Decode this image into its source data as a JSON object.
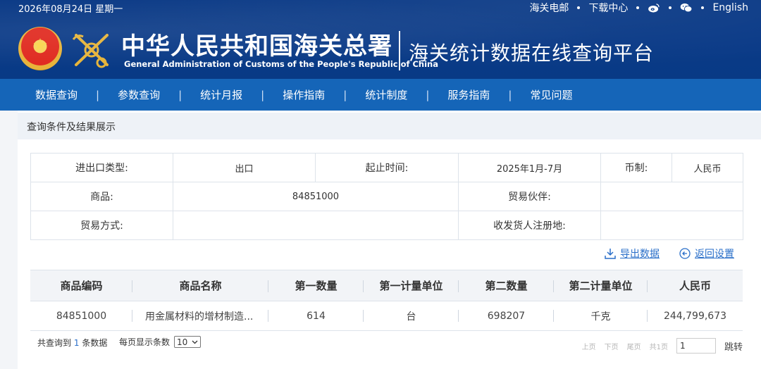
{
  "topbar": {
    "date": "2026年08月24日 星期一",
    "links": [
      "海关电邮",
      "下载中心",
      "English"
    ]
  },
  "header": {
    "cn_title": "中华人民共和国海关总署",
    "en_title": "General Administration of Customs of the People's Republic of China",
    "platform": "海关统计数据在线查询平台"
  },
  "nav": {
    "items": [
      "数据查询",
      "参数查询",
      "统计月报",
      "操作指南",
      "统计制度",
      "服务指南",
      "常见问题"
    ]
  },
  "section_title": "查询条件及结果展示",
  "criteria": {
    "trade_type_label": "进出口类型:",
    "trade_type_value": "出口",
    "period_label": "起止时间:",
    "period_value": "2025年1月-7月",
    "currency_label": "币制:",
    "currency_value": "人民币",
    "goods_label": "商品:",
    "goods_value": "84851000",
    "partner_label": "贸易伙伴:",
    "partner_value": "",
    "mode_label": "贸易方式:",
    "mode_value": "",
    "consignee_label": "收发货人注册地:",
    "consignee_value": ""
  },
  "actions": {
    "export": "导出数据",
    "reset": "返回设置"
  },
  "results": {
    "headers": [
      "商品编码",
      "商品名称",
      "第一数量",
      "第一计量单位",
      "第二数量",
      "第二计量单位",
      "人民币"
    ],
    "rows": [
      [
        "84851000",
        "用金属材料的增材制造...",
        "614",
        "台",
        "698207",
        "千克",
        "244,799,673"
      ]
    ]
  },
  "pagination": {
    "summary_prefix": "共查询到",
    "count": "1",
    "summary_suffix": "条数据",
    "per_page_label": "每页显示条数",
    "per_page_value": "10",
    "prev": "上页",
    "next": "下页",
    "last": "尾页",
    "total_pages": "共1页",
    "page_input": "1",
    "goto": "跳转"
  },
  "colors": {
    "header_bg": "#0a3a87",
    "nav_bg": "#1565b8",
    "link": "#2a6fc9"
  }
}
